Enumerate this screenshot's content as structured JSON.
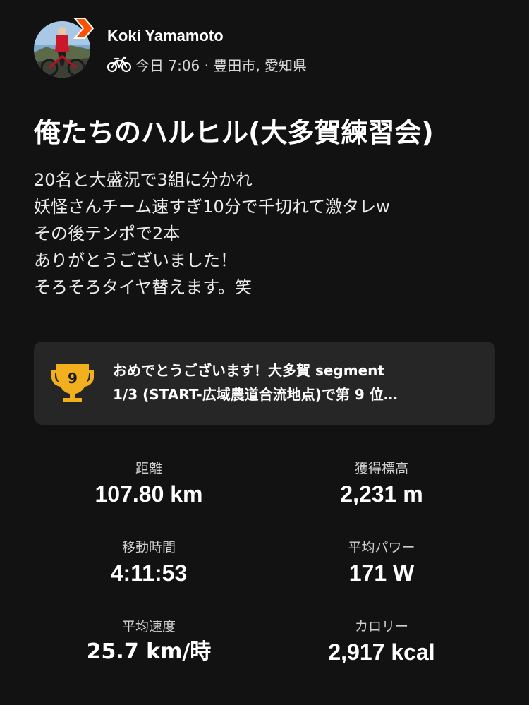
{
  "header": {
    "athlete_name": "Koki Yamamoto",
    "activity_type_icon": "bike-icon",
    "meta": "今日 7:06 · 豊田市, 愛知県",
    "badge_icon": "strava-chevron-badge-icon",
    "badge_color": "#fc5200"
  },
  "activity": {
    "title": "俺たちのハルヒル(大多賀練習会)",
    "description_lines": [
      "20名と大盛況で3組に分かれ",
      "妖怪さんチーム速すぎ10分で千切れて激タレw",
      "その後テンポで2本",
      "ありがとうございました！",
      "そろそろタイヤ替えます。笑"
    ]
  },
  "achievement": {
    "icon": "trophy-icon",
    "rank": "9",
    "trophy_color": "#f2b01e",
    "lines": [
      "おめでとうございます！大多賀 segment",
      "1/3 (START-広域農道合流地点)で第 9 位…"
    ]
  },
  "stats": [
    {
      "label": "距離",
      "value": "107.80 km"
    },
    {
      "label": "獲得標高",
      "value": "2,231 m"
    },
    {
      "label": "移動時間",
      "value": "4:11:53"
    },
    {
      "label": "平均パワー",
      "value": "171 W"
    },
    {
      "label": "平均速度",
      "value": "25.7 km/時"
    },
    {
      "label": "カロリー",
      "value": "2,917 kcal"
    }
  ]
}
